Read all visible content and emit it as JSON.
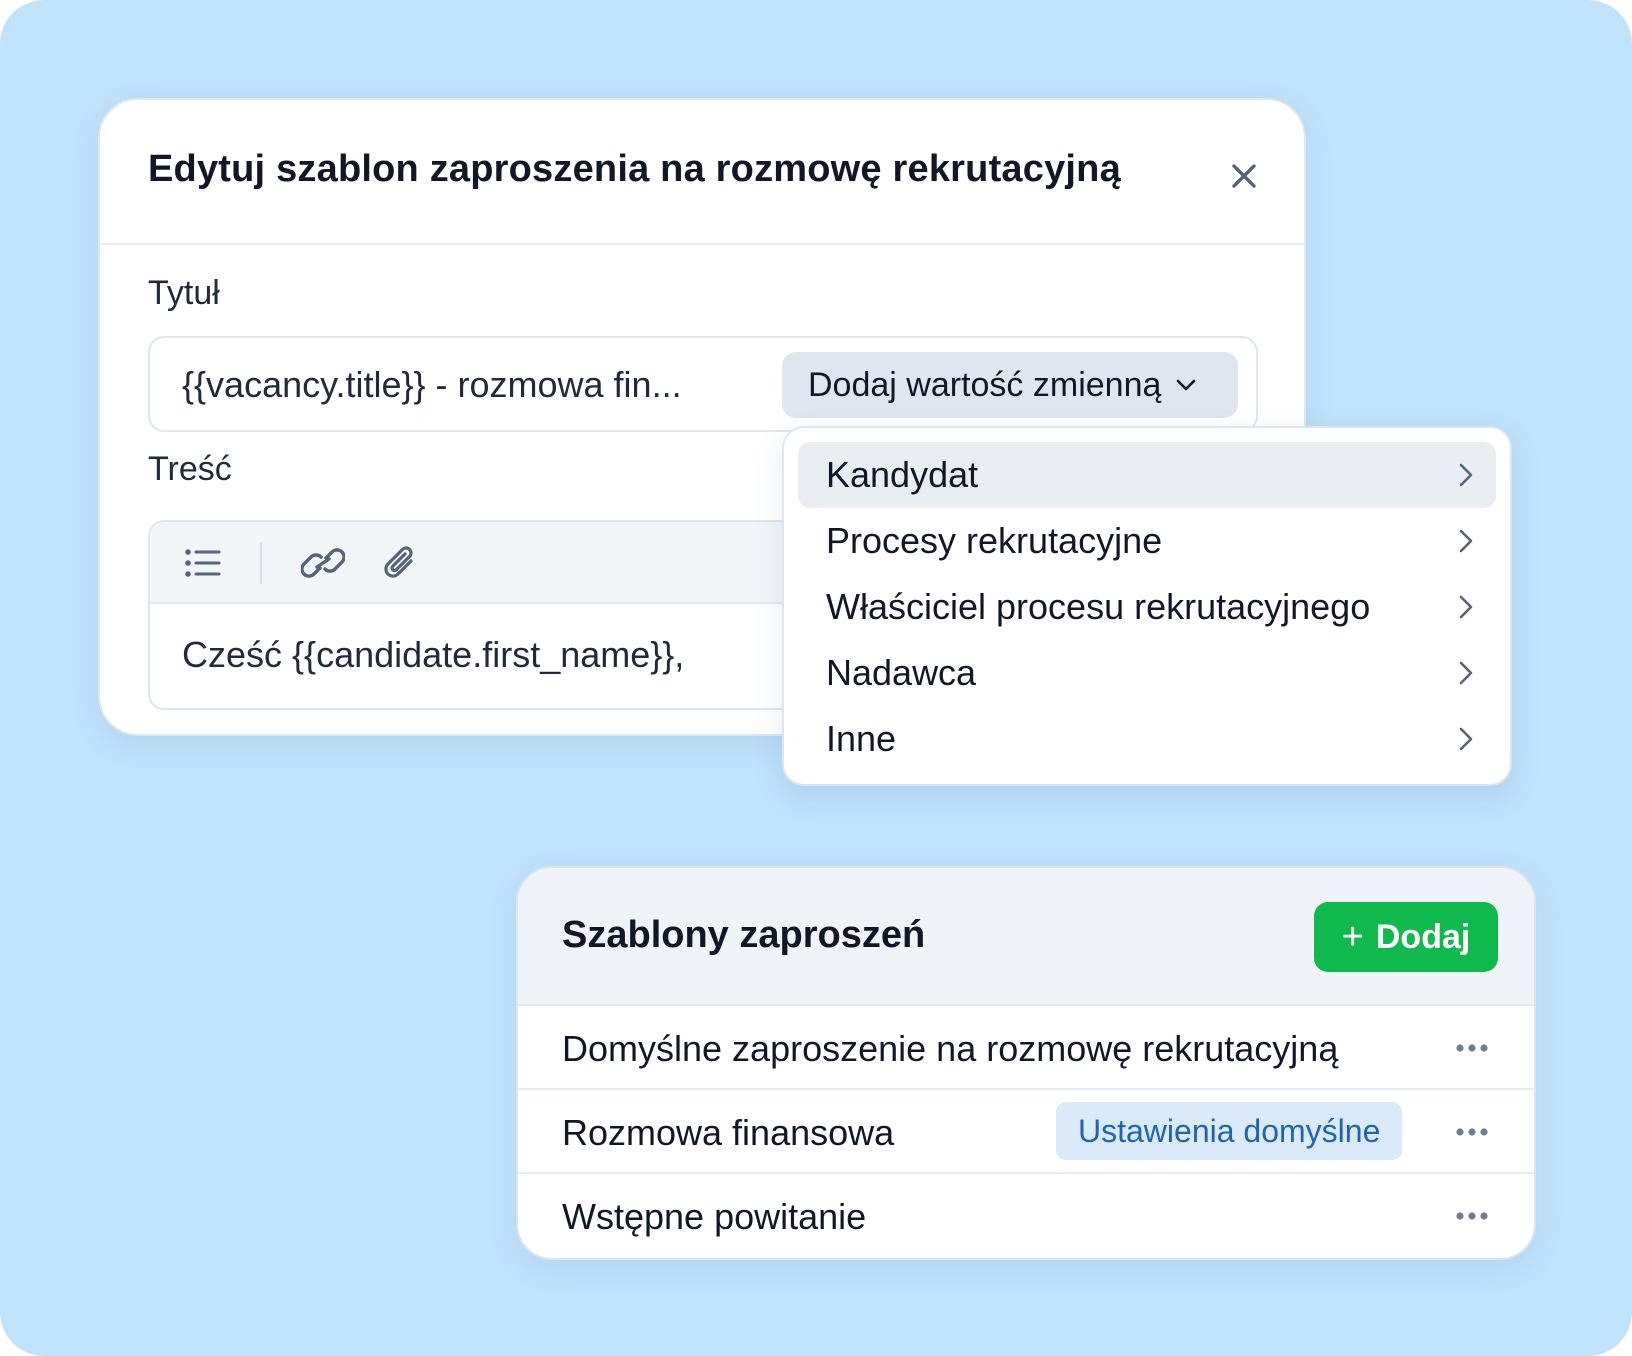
{
  "editor": {
    "title": "Edytuj szablon zaproszenia na rozmowę rekrutacyjną",
    "close_icon": "close-icon",
    "title_label": "Tytuł",
    "title_value": "{{vacancy.title}} - rozmowa fin...",
    "variable_button_label": "Dodaj wartość zmienną",
    "body_label": "Treść",
    "toolbar_icons": [
      "list-icon",
      "link-icon",
      "paperclip-icon"
    ],
    "body_text": "Cześć {{candidate.first_name}},"
  },
  "variable_menu": {
    "items": [
      {
        "label": "Kandydat",
        "active": true
      },
      {
        "label": "Procesy rekrutacyjne",
        "active": false
      },
      {
        "label": "Właściciel procesu rekrutacyjnego",
        "active": false
      },
      {
        "label": "Nadawca",
        "active": false
      },
      {
        "label": "Inne",
        "active": false
      }
    ]
  },
  "templates": {
    "title": "Szablony zaproszeń",
    "add_button_label": "Dodaj",
    "rows": [
      {
        "name": "Domyślne zaproszenie na rozmowę rekrutacyjną",
        "badge": ""
      },
      {
        "name": "Rozmowa finansowa",
        "badge": "Ustawienia domyślne"
      },
      {
        "name": "Wstępne powitanie",
        "badge": ""
      }
    ]
  },
  "colors": {
    "background": "#c1e2fb",
    "accent_green": "#10b94d",
    "badge_bg": "#dbeafb",
    "badge_text": "#1e63b8"
  }
}
